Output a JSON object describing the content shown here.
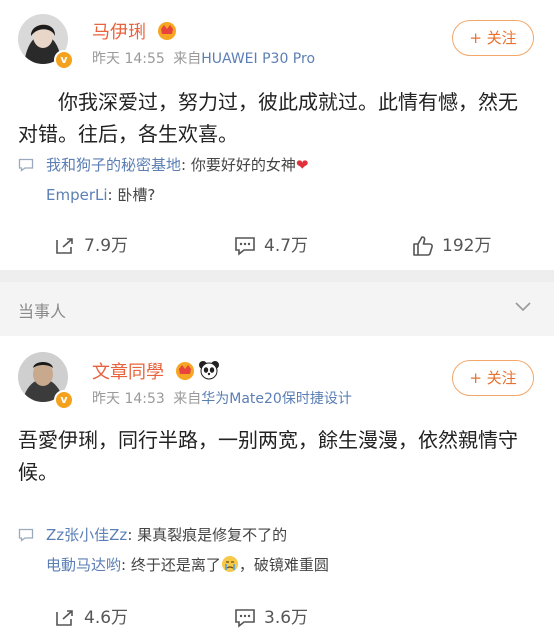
{
  "posts": [
    {
      "username": "马伊琍",
      "time": "昨天 14:55",
      "source_prefix": "来自",
      "source": "HUAWEI P30 Pro",
      "follow_label": "+ 关注",
      "text": "你我深爱过，努力过，彼此成就过。此情有憾，然无对错。往后，各生欢喜。",
      "comments": [
        {
          "author": "我和狗子的秘密基地",
          "text": ": 你要好好的女神"
        },
        {
          "author": "EmperLi",
          "text": ": 卧槽?"
        }
      ],
      "actions": {
        "repost": "7.9万",
        "comment": "4.7万",
        "like": "192万"
      }
    },
    {
      "username": "文章同學",
      "time": "昨天 14:53",
      "source_prefix": "来自",
      "source": "华为Mate20保时捷设计",
      "follow_label": "+ 关注",
      "text": "吾愛伊琍，同行半路，一别两宽，餘生漫漫，依然親情守候。",
      "comments": [
        {
          "author": "Zz张小佳Zz",
          "text": ": 果真裂痕是修复不了的"
        },
        {
          "author": "电動马达哟",
          "text_a": ": 终于还是离了",
          "text_b": "，破镜难重圆"
        }
      ],
      "actions": {
        "repost": "4.6万",
        "comment": "3.6万"
      }
    }
  ],
  "section_label": "当事人",
  "colors": {
    "username": "#e8633d",
    "link": "#5b7fb5",
    "follow": "#e8712f",
    "verified": "#f4a21e"
  }
}
